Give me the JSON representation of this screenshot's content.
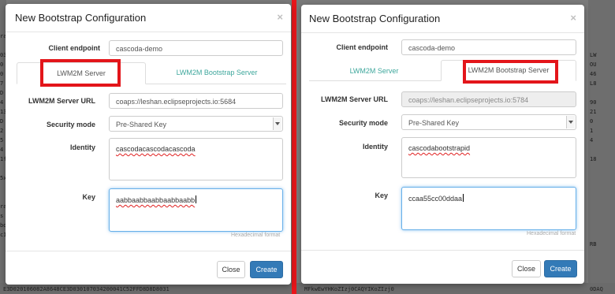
{
  "background": {
    "left_rows": [
      "ra",
      "",
      "03",
      "0",
      "0",
      "7",
      "D",
      "4",
      "13",
      "D",
      "2",
      "5",
      "4",
      "1f",
      "",
      "5x",
      "",
      "",
      "ra",
      "s",
      "bd",
      "c1"
    ],
    "right_rows": [
      "",
      "",
      "LW",
      "OU",
      "46",
      "L8",
      "",
      "90",
      "21",
      "0",
      "1",
      "4",
      "",
      "18",
      "",
      "",
      "",
      "",
      "",
      "",
      "",
      "",
      "RB"
    ],
    "bottom_left_text": "E3D020106082A8648CE3D030107034200041C52FFD8D8D8031",
    "bottom_right_text": "MFkwEwYHKoZIzj0CAQYIKoZIzj0",
    "bottom_right_tail": "0DAQ"
  },
  "left_modal": {
    "title": "New Bootstrap Configuration",
    "close_symbol": "×",
    "client_endpoint_label": "Client endpoint",
    "client_endpoint_value": "cascoda-demo",
    "tabs": [
      "LWM2M Server",
      "LWM2M Bootstrap Server"
    ],
    "active_tab": "LWM2M Server",
    "server_url_label": "LWM2M Server URL",
    "server_url_value": "coaps://leshan.eclipseprojects.io:5684",
    "security_mode_label": "Security mode",
    "security_mode_value": "Pre-Shared Key",
    "identity_label": "Identity",
    "identity_value": "cascodacascodacascoda",
    "key_label": "Key",
    "key_value": "aabbaabbaabbaabbaabb",
    "key_help": "Hexadecimal format",
    "close_button": "Close",
    "create_button": "Create"
  },
  "right_modal": {
    "title": "New Bootstrap Configuration",
    "close_symbol": "×",
    "client_endpoint_label": "Client endpoint",
    "client_endpoint_value": "cascoda-demo",
    "tabs": [
      "LWM2M Server",
      "LWM2M Bootstrap Server"
    ],
    "active_tab": "LWM2M Bootstrap Server",
    "server_url_label": "LWM2M Server URL",
    "server_url_value": "coaps://leshan.eclipseprojects.io:5784",
    "security_mode_label": "Security mode",
    "security_mode_value": "Pre-Shared Key",
    "identity_label": "Identity",
    "identity_value": "cascodabootstrapid",
    "key_label": "Key",
    "key_value": "ccaa55cc00ddaa",
    "key_help": "Hexadecimal format",
    "close_button": "Close",
    "create_button": "Create"
  },
  "colors": {
    "highlight_box": "#e3151a",
    "divider": "#e8161b",
    "tab_link": "#3ea79c",
    "primary_button": "#337ab7"
  }
}
